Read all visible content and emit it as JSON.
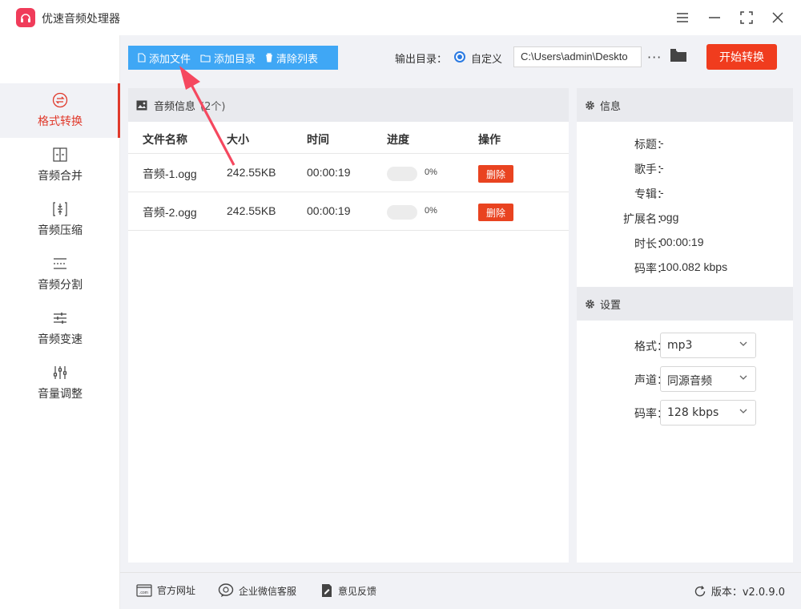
{
  "app": {
    "title": "优速音频处理器",
    "accent_color": "#e0392b",
    "brand_color": "#f03c5a"
  },
  "window_controls": [
    "menu-icon",
    "minimize-icon",
    "maximize-icon",
    "close-icon"
  ],
  "sidebar": {
    "items": [
      {
        "label": "格式转换",
        "icon": "format-convert-icon",
        "active": true
      },
      {
        "label": "音频合并",
        "icon": "merge-icon",
        "active": false
      },
      {
        "label": "音频压缩",
        "icon": "compress-icon",
        "active": false
      },
      {
        "label": "音频分割",
        "icon": "split-icon",
        "active": false
      },
      {
        "label": "音频变速",
        "icon": "speed-icon",
        "active": false
      },
      {
        "label": "音量调整",
        "icon": "volume-icon",
        "active": false
      }
    ]
  },
  "toolbar": {
    "add_file": "添加文件",
    "add_dir": "添加目录",
    "clear_list": "清除列表",
    "button_color": "#3fa7f5"
  },
  "output": {
    "label": "输出目录：",
    "mode": "自定义",
    "path": "C:\\Users\\admin\\Deskto",
    "more": "···",
    "start": "开始转换",
    "start_color": "#f03c1e"
  },
  "file_panel": {
    "title": "音频信息",
    "count": "(2个)",
    "columns": [
      "文件名称",
      "大小",
      "时间",
      "进度",
      "操作"
    ],
    "rows": [
      {
        "name": "音频-1.ogg",
        "size": "242.55KB",
        "time": "00:00:19",
        "progress": "0%",
        "action": "删除"
      },
      {
        "name": "音频-2.ogg",
        "size": "242.55KB",
        "time": "00:00:19",
        "progress": "0%",
        "action": "删除"
      }
    ]
  },
  "info": {
    "title": "信息",
    "rows": [
      {
        "key": "标题：",
        "value": "-"
      },
      {
        "key": "歌手：",
        "value": "-"
      },
      {
        "key": "专辑：",
        "value": "-"
      },
      {
        "key": "扩展名：",
        "value": "ogg"
      },
      {
        "key": "时长：",
        "value": "00:00:19"
      },
      {
        "key": "码率：",
        "value": "100.082 kbps"
      }
    ]
  },
  "settings": {
    "title": "设置",
    "rows": [
      {
        "key": "格式：",
        "value": "mp3"
      },
      {
        "key": "声道：",
        "value": "同源音频"
      },
      {
        "key": "码率：",
        "value": "128 kbps"
      }
    ]
  },
  "footer": {
    "website": "官方网址",
    "wechat": "企业微信客服",
    "feedback": "意见反馈",
    "version": "版本：v2.0.9.0"
  }
}
